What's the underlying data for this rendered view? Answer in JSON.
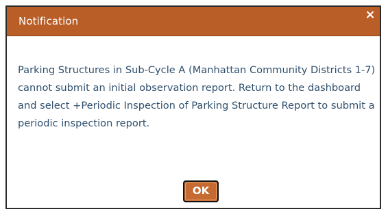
{
  "dialog": {
    "title": "Notification",
    "close_label": "×",
    "message": "Parking Structures in Sub-Cycle A (Manhattan Community Districts 1-7) cannot submit an initial observation report. Return to the dashboard and select +Periodic Inspection of Parking Structure Report to submit a periodic inspection report.",
    "ok_label": "OK"
  },
  "colors": {
    "titlebar": "#b95e27",
    "button": "#c56a30",
    "message_text": "#2f4f6d"
  }
}
